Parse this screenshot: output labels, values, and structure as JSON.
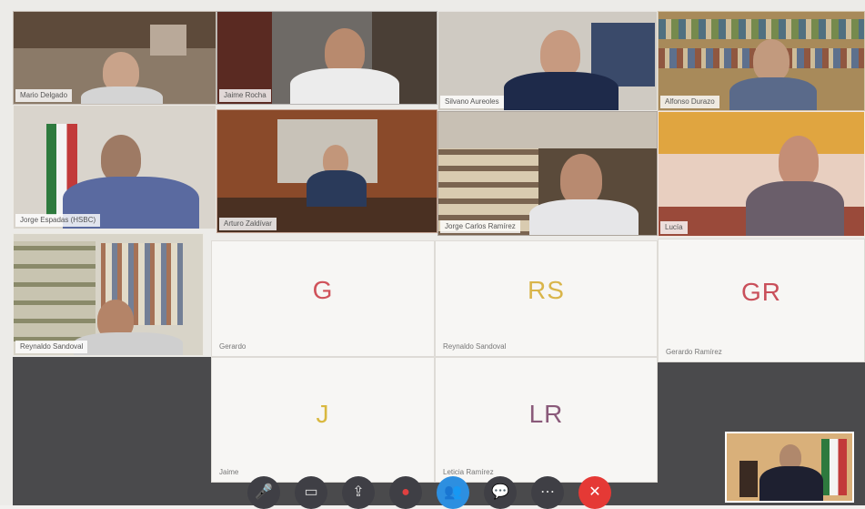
{
  "participants": [
    {
      "name": "Mario Delgado"
    },
    {
      "name": "Jaime Rocha"
    },
    {
      "name": "Silvano Aureoles"
    },
    {
      "name": "Alfonso Durazo"
    },
    {
      "name": "Jorge Espadas (HSBC)"
    },
    {
      "name": "Arturo Zaldívar"
    },
    {
      "name": "Jorge Carlos Ramírez"
    },
    {
      "name": "Lucía"
    },
    {
      "name": "Reynaldo Sandoval"
    }
  ],
  "avatars": [
    {
      "initials": "G",
      "label": "Gerardo",
      "color": "#d0525a"
    },
    {
      "initials": "RS",
      "label": "Reynaldo Sandoval",
      "color": "#d9b54a"
    },
    {
      "initials": "GR",
      "label": "Gerardo Ramírez",
      "color": "#c94f5a"
    },
    {
      "initials": "J",
      "label": "Jaime",
      "color": "#d9b83f"
    },
    {
      "initials": "LR",
      "label": "Leticia Ramírez",
      "color": "#8a5a7a"
    }
  ],
  "toolbar": {
    "buttons": [
      "mic",
      "video",
      "share",
      "record",
      "participants",
      "chat",
      "more",
      "leave"
    ]
  }
}
